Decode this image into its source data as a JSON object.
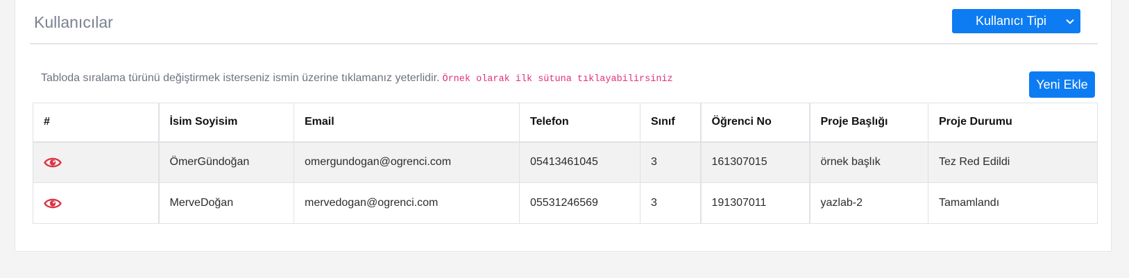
{
  "header": {
    "title": "Kullanıcılar",
    "type_button_label": "Kullanıcı Tipi"
  },
  "hint": {
    "text": "Tabloda sıralama türünü değiştirmek isterseniz ismin üzerine tıklamanız yeterlidir.",
    "code": "Örnek olarak ilk sütuna tıklayabilirsiniz"
  },
  "add_button_label": "Yeni Ekle",
  "table": {
    "columns": [
      "#",
      "İsim Soyisim",
      "Email",
      "Telefon",
      "Sınıf",
      "Öğrenci No",
      "Proje Başlığı",
      "Proje Durumu"
    ],
    "rows": [
      {
        "icon": "eye-icon",
        "name": "ÖmerGündoğan",
        "email": "omergundogan@ogrenci.com",
        "phone": "05413461045",
        "class": "3",
        "student_no": "161307015",
        "project_title": "örnek başlık",
        "project_status": "Tez Red Edildi"
      },
      {
        "icon": "eye-icon",
        "name": "MerveDoğan",
        "email": "mervedogan@ogrenci.com",
        "phone": "05531246569",
        "class": "3",
        "student_no": "191307011",
        "project_title": "yazlab-2",
        "project_status": "Tamamlandı"
      }
    ]
  },
  "colors": {
    "primary": "#0d7cf2",
    "eye_icon": "#dc3545",
    "hint_code": "#e0307a",
    "title": "#7a8191"
  }
}
